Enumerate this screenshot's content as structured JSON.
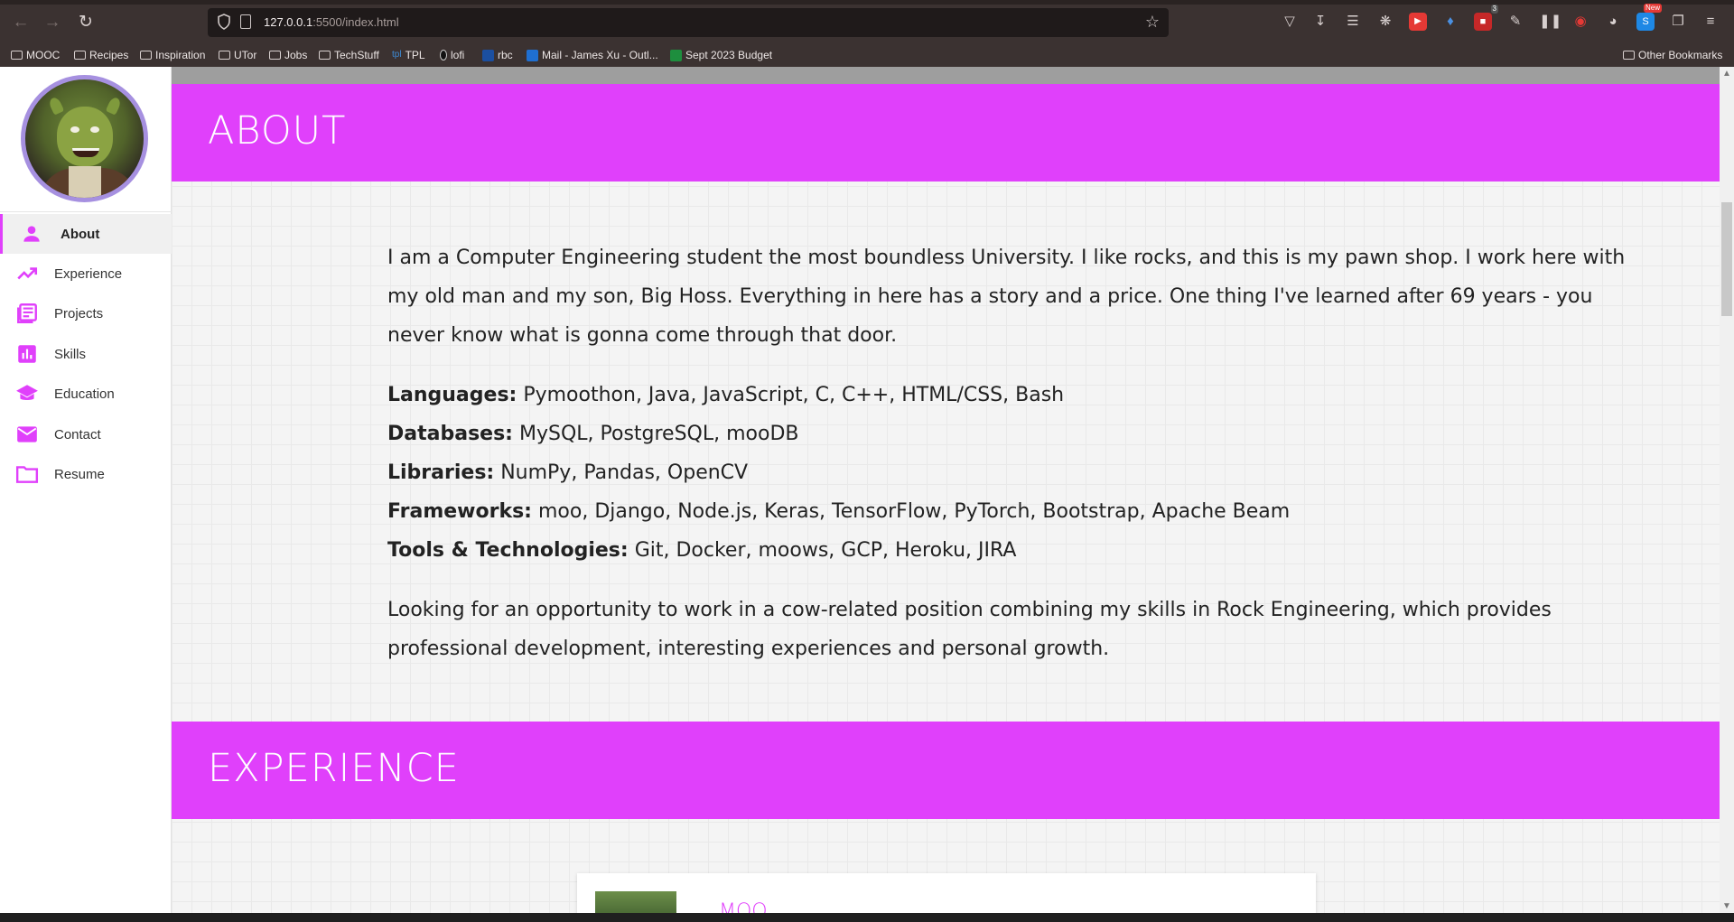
{
  "browser": {
    "url_host": "127.0.0.1",
    "url_rest": ":5500/index.html",
    "bookmarks": [
      "MOOC",
      "Recipes",
      "Inspiration",
      "UTor",
      "Jobs",
      "TechStuff",
      "TPL",
      "lofi",
      "rbc",
      "Mail - James Xu - Outl...",
      "Sept 2023 Budget"
    ],
    "other_bookmarks": "Other Bookmarks",
    "badge_count": "3",
    "badge_new": "New"
  },
  "sidebar": {
    "items": [
      {
        "label": "About",
        "icon": "person-icon"
      },
      {
        "label": "Experience",
        "icon": "trending-up-icon"
      },
      {
        "label": "Projects",
        "icon": "list-icon"
      },
      {
        "label": "Skills",
        "icon": "bar-chart-icon"
      },
      {
        "label": "Education",
        "icon": "school-icon"
      },
      {
        "label": "Contact",
        "icon": "mail-icon"
      },
      {
        "label": "Resume",
        "icon": "folder-icon"
      }
    ],
    "active": "About"
  },
  "about": {
    "heading": "ABOUT",
    "intro": "I am a Computer Engineering student the most boundless University. I like rocks, and this is my pawn shop. I work here with my old man and my son, Big Hoss. Everything in here has a story and a price. One thing I've learned after 69 years - you never know what is gonna come through that door.",
    "skills": [
      {
        "label": "Languages:",
        "value": " Pymoothon, Java, JavaScript, C, C++, HTML/CSS, Bash"
      },
      {
        "label": "Databases:",
        "value": " MySQL, PostgreSQL, mooDB"
      },
      {
        "label": "Libraries:",
        "value": " NumPy, Pandas, OpenCV"
      },
      {
        "label": "Frameworks:",
        "value": " moo, Django, Node.js, Keras, TensorFlow, PyTorch, Bootstrap, Apache Beam"
      },
      {
        "label": "Tools & Technologies:",
        "value": " Git, Docker, moows, GCP, Heroku, JIRA"
      }
    ],
    "looking": "Looking for an opportunity to work in a cow-related position combining my skills in Rock Engineering, which provides professional development, interesting experiences and personal growth."
  },
  "experience": {
    "heading": "EXPERIENCE",
    "first_title": "MOO"
  },
  "colors": {
    "accent": "#e040fb",
    "avatar_border": "#a690e0"
  }
}
